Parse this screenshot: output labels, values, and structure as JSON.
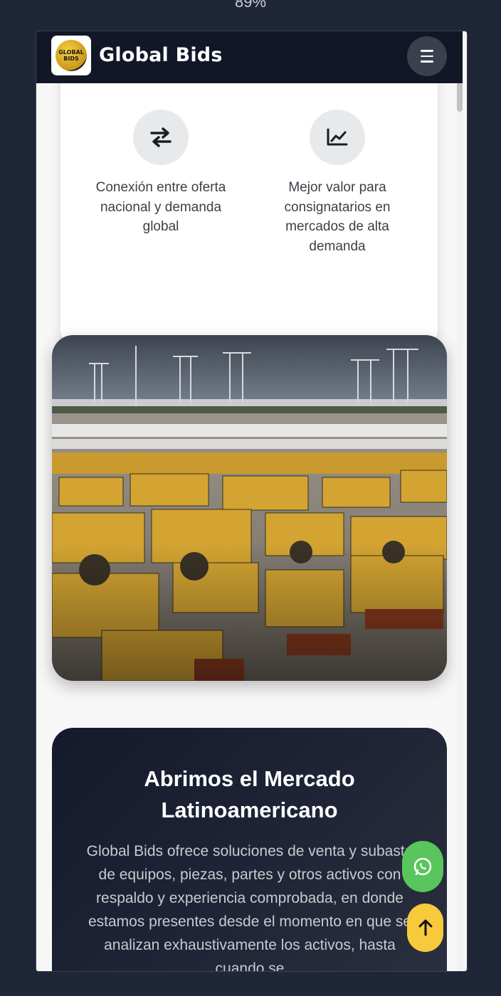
{
  "browser": {
    "zoom_label": "89%"
  },
  "header": {
    "brand": "Global Bids",
    "logo_text": "GLOBAL BIDS",
    "menu_icon": "hamburger-icon"
  },
  "features": [
    {
      "icon": "swap-arrows-icon",
      "text": "Conexión entre oferta nacional y demanda global"
    },
    {
      "icon": "trend-chart-icon",
      "text": "Mejor valor para consignatarios en mercados de alta demanda"
    }
  ],
  "hero_image": {
    "subject": "mining-equipment-yard-photo"
  },
  "market_section": {
    "title_line1": "Abrimos el Mercado",
    "title_line2": "Latinoamericano",
    "body": "Global Bids ofrece soluciones de venta y subasta de equipos, piezas, partes y otros activos con respaldo y experiencia comprobada, en donde estamos presentes desde el momento en que se analizan exhaustivamente los activos, hasta cuando se"
  },
  "floating": {
    "whatsapp_icon": "whatsapp-icon",
    "scroll_top_icon": "arrow-up-icon"
  },
  "colors": {
    "navbar": "#111727",
    "whatsapp": "#58c55d",
    "scroll_top": "#f6ca3b",
    "page_bg": "#1f2637"
  }
}
